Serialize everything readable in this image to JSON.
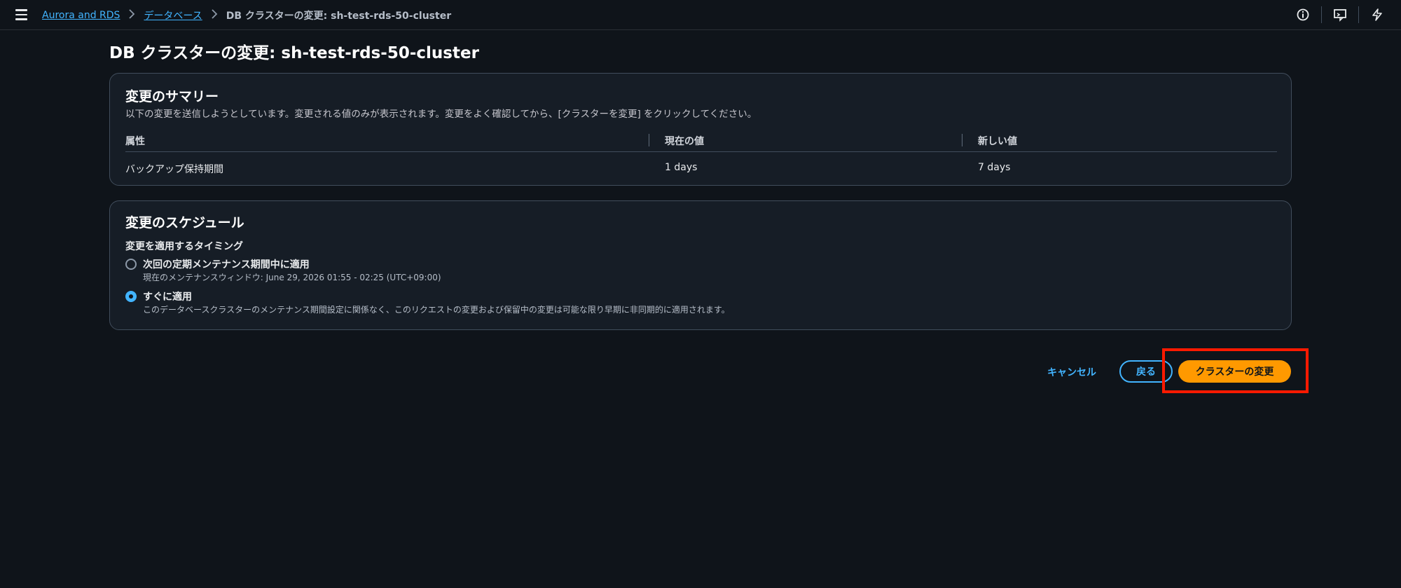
{
  "breadcrumb": {
    "items": [
      "Aurora and RDS",
      "データベース"
    ],
    "current": "DB クラスターの変更: sh-test-rds-50-cluster"
  },
  "page": {
    "title": "DB クラスターの変更: sh-test-rds-50-cluster"
  },
  "summary": {
    "title": "変更のサマリー",
    "description": "以下の変更を送信しようとしています。変更される値のみが表示されます。変更をよく確認してから、[クラスターを変更] をクリックしてください。",
    "columns": [
      "属性",
      "現在の値",
      "新しい値"
    ],
    "rows": [
      {
        "attribute": "バックアップ保持期間",
        "current": "1 days",
        "new": "7 days"
      }
    ]
  },
  "schedule": {
    "title": "変更のスケジュール",
    "group_label": "変更を適用するタイミング",
    "options": [
      {
        "label": "次回の定期メンテナンス期間中に適用",
        "description": "現在のメンテナンスウィンドウ: June 29, 2026 01:55 - 02:25 (UTC+09:00)",
        "selected": false
      },
      {
        "label": "すぐに適用",
        "description": "このデータベースクラスターのメンテナンス期間設定に関係なく、このリクエストの変更および保留中の変更は可能な限り早期に非同期的に適用されます。",
        "selected": true
      }
    ]
  },
  "actions": {
    "cancel": "キャンセル",
    "back": "戻る",
    "modify": "クラスターの変更"
  },
  "colors": {
    "background": "#0f141a",
    "panel": "#161d26",
    "link": "#42b4ff",
    "primary": "#ff9900",
    "highlight": "#ff1a00"
  },
  "icons": [
    "menu-icon",
    "chevron-right-icon",
    "info-icon",
    "feedback-icon",
    "lightning-icon"
  ]
}
